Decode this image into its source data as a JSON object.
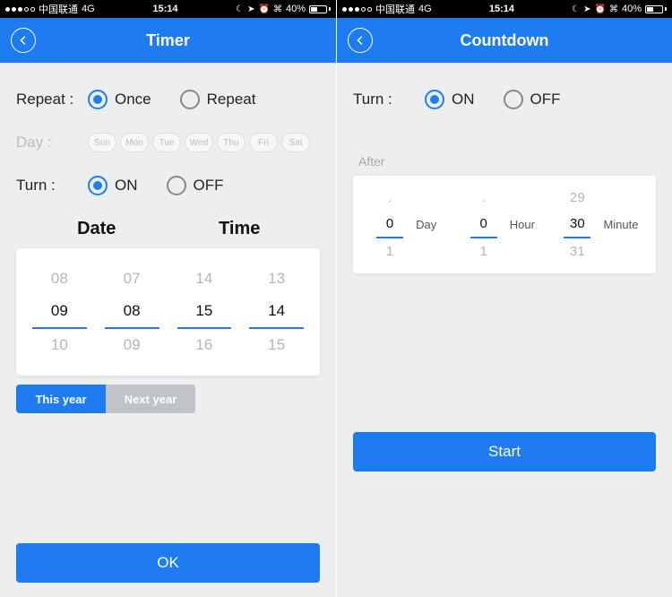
{
  "statusbar": {
    "carrier": "中国联通",
    "network": "4G",
    "time": "15:14",
    "battery_pct": "40%"
  },
  "timer": {
    "title": "Timer",
    "repeat_label": "Repeat :",
    "repeat_once": "Once",
    "repeat_repeat": "Repeat",
    "repeat_selected": "once",
    "day_label": "Day :",
    "days": [
      "Sun",
      "Mon",
      "Tue",
      "Wed",
      "Thu",
      "Fri",
      "Sat"
    ],
    "turn_label": "Turn :",
    "turn_on": "ON",
    "turn_off": "OFF",
    "turn_selected": "on",
    "date_header": "Date",
    "time_header": "Time",
    "picker": {
      "month": {
        "prev": "08",
        "sel": "09",
        "next": "10"
      },
      "day": {
        "prev": "07",
        "sel": "08",
        "next": "09"
      },
      "hour": {
        "prev": "14",
        "sel": "15",
        "next": "16"
      },
      "minute": {
        "prev": "13",
        "sel": "14",
        "next": "15"
      }
    },
    "this_year": "This year",
    "next_year": "Next year",
    "year_selected": "this_year",
    "ok": "OK"
  },
  "countdown": {
    "title": "Countdown",
    "turn_label": "Turn :",
    "turn_on": "ON",
    "turn_off": "OFF",
    "turn_selected": "on",
    "after_label": "After",
    "day": {
      "sel": "0",
      "next": "1",
      "label": "Day"
    },
    "hour": {
      "sel": "0",
      "next": "1",
      "label": "Hour"
    },
    "minute": {
      "prev": "29",
      "sel": "30",
      "next": "31",
      "label": "Minute"
    },
    "start": "Start"
  }
}
